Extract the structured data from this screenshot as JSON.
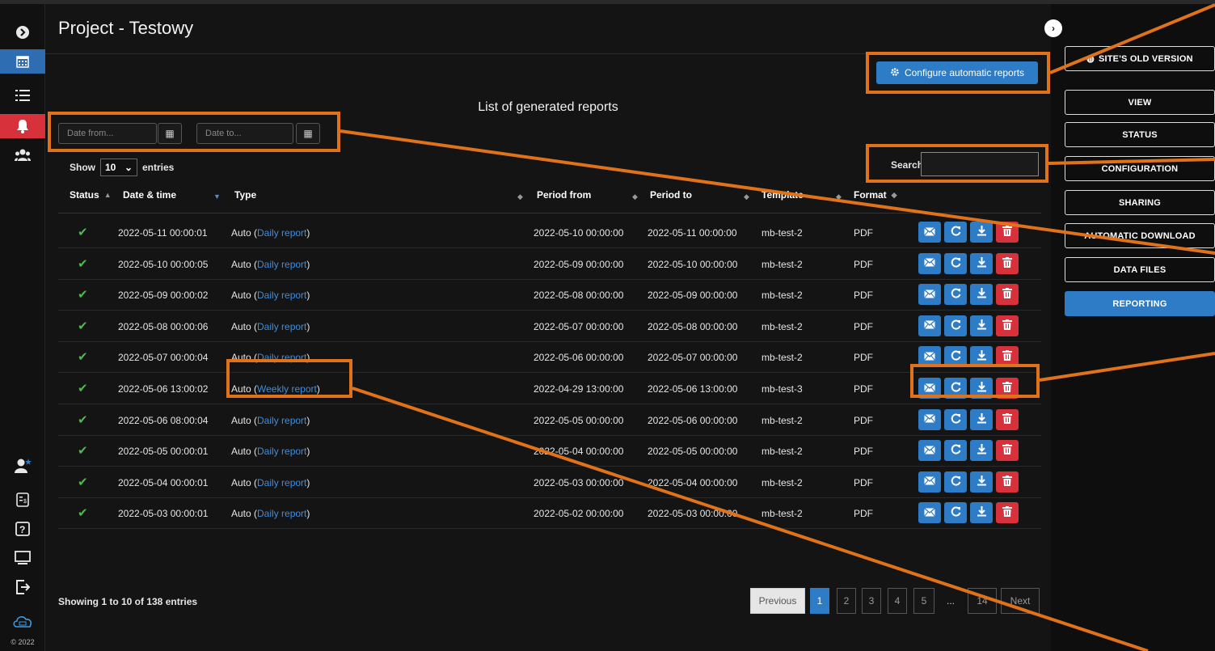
{
  "page": {
    "title": "Project - Testowy",
    "list_title": "List of generated reports",
    "copyright": "© 2022"
  },
  "toolbar": {
    "configure_label": "Configure automatic reports"
  },
  "filters": {
    "date_from_placeholder": "Date from...",
    "date_to_placeholder": "Date to..."
  },
  "entries": {
    "show_label": "Show",
    "value": "10",
    "suffix": "entries"
  },
  "search": {
    "label": "Search:"
  },
  "table": {
    "headers": {
      "status": "Status",
      "datetime": "Date & time",
      "type": "Type",
      "period_from": "Period from",
      "period_to": "Period to",
      "template": "Template",
      "format": "Format"
    },
    "rows": [
      {
        "datetime": "2022-05-11 00:00:01",
        "type_prefix": "Auto (",
        "type_link": "Daily report",
        "type_suffix": ")",
        "period_from": "2022-05-10 00:00:00",
        "period_to": "2022-05-11 00:00:00",
        "template": "mb-test-2",
        "format": "PDF"
      },
      {
        "datetime": "2022-05-10 00:00:05",
        "type_prefix": "Auto (",
        "type_link": "Daily report",
        "type_suffix": ")",
        "period_from": "2022-05-09 00:00:00",
        "period_to": "2022-05-10 00:00:00",
        "template": "mb-test-2",
        "format": "PDF"
      },
      {
        "datetime": "2022-05-09 00:00:02",
        "type_prefix": "Auto (",
        "type_link": "Daily report",
        "type_suffix": ")",
        "period_from": "2022-05-08 00:00:00",
        "period_to": "2022-05-09 00:00:00",
        "template": "mb-test-2",
        "format": "PDF"
      },
      {
        "datetime": "2022-05-08 00:00:06",
        "type_prefix": "Auto (",
        "type_link": "Daily report",
        "type_suffix": ")",
        "period_from": "2022-05-07 00:00:00",
        "period_to": "2022-05-08 00:00:00",
        "template": "mb-test-2",
        "format": "PDF"
      },
      {
        "datetime": "2022-05-07 00:00:04",
        "type_prefix": "Auto (",
        "type_link": "Daily report",
        "type_suffix": ")",
        "period_from": "2022-05-06 00:00:00",
        "period_to": "2022-05-07 00:00:00",
        "template": "mb-test-2",
        "format": "PDF"
      },
      {
        "datetime": "2022-05-06 13:00:02",
        "type_prefix": "Auto (",
        "type_link": "Weekly report",
        "type_suffix": ")",
        "period_from": "2022-04-29 13:00:00",
        "period_to": "2022-05-06 13:00:00",
        "template": "mb-test-3",
        "format": "PDF"
      },
      {
        "datetime": "2022-05-06 08:00:04",
        "type_prefix": "Auto (",
        "type_link": "Daily report",
        "type_suffix": ")",
        "period_from": "2022-05-05 00:00:00",
        "period_to": "2022-05-06 00:00:00",
        "template": "mb-test-2",
        "format": "PDF"
      },
      {
        "datetime": "2022-05-05 00:00:01",
        "type_prefix": "Auto (",
        "type_link": "Daily report",
        "type_suffix": ")",
        "period_from": "2022-05-04 00:00:00",
        "period_to": "2022-05-05 00:00:00",
        "template": "mb-test-2",
        "format": "PDF"
      },
      {
        "datetime": "2022-05-04 00:00:01",
        "type_prefix": "Auto (",
        "type_link": "Daily report",
        "type_suffix": ")",
        "period_from": "2022-05-03 00:00:00",
        "period_to": "2022-05-04 00:00:00",
        "template": "mb-test-2",
        "format": "PDF"
      },
      {
        "datetime": "2022-05-03 00:00:01",
        "type_prefix": "Auto (",
        "type_link": "Daily report",
        "type_suffix": ")",
        "period_from": "2022-05-02 00:00:00",
        "period_to": "2022-05-03 00:00:00",
        "template": "mb-test-2",
        "format": "PDF"
      }
    ]
  },
  "footer": {
    "showing": "Showing 1 to 10 of 138 entries"
  },
  "pagination": {
    "previous": "Previous",
    "next": "Next",
    "ellipsis": "...",
    "last": "14",
    "pages": [
      "1",
      "2",
      "3",
      "4",
      "5"
    ]
  },
  "sidebar": {
    "buttons": [
      "SITE'S OLD VERSION",
      "VIEW",
      "STATUS",
      "CONFIGURATION",
      "SHARING",
      "AUTOMATIC DOWNLOAD",
      "DATA FILES",
      "REPORTING"
    ],
    "active": "REPORTING"
  },
  "colors": {
    "accent": "#2e7bc6",
    "danger": "#d7323b",
    "success": "#4fb84f",
    "annotation": "#e0731a",
    "background": "#141414"
  },
  "icons": {
    "rail": [
      "expand-icon",
      "calendar-icon",
      "list-icon",
      "bell-icon",
      "users-icon",
      "user-star-icon",
      "invoice-icon",
      "help-icon",
      "monitor-icon",
      "logout-icon",
      "cloud-icon"
    ],
    "row_actions": [
      "email-icon",
      "refresh-icon",
      "download-icon",
      "trash-icon"
    ]
  }
}
